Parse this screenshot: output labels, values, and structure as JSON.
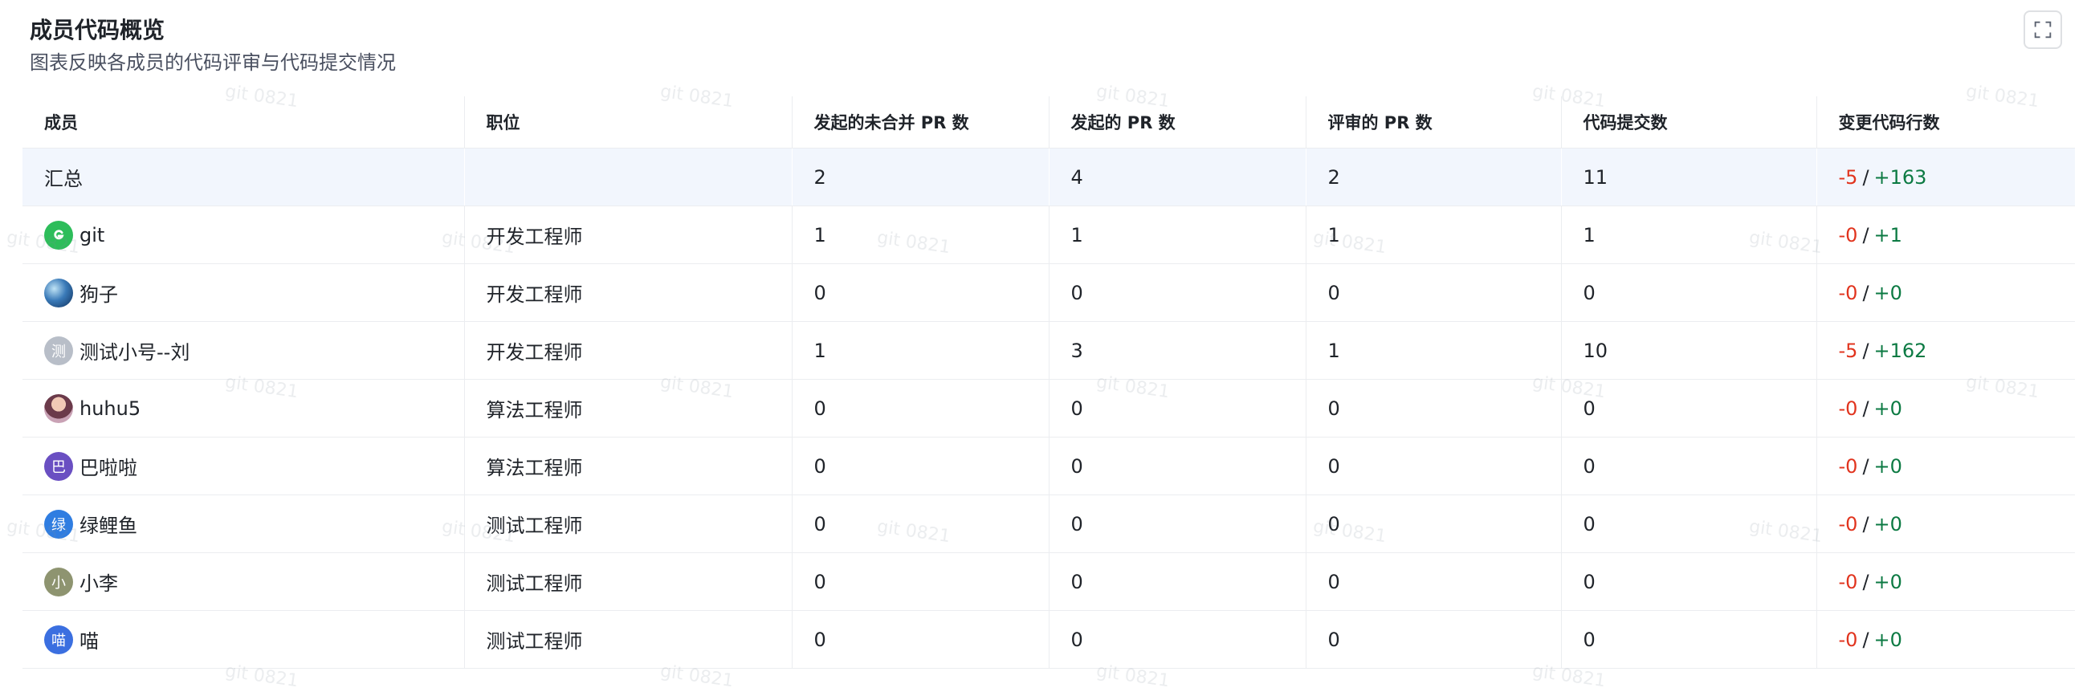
{
  "header": {
    "title": "成员代码概览",
    "subtitle": "图表反映各成员的代码评审与代码提交情况"
  },
  "toolbar": {
    "fullscreen_icon": "fullscreen-icon"
  },
  "table": {
    "columns": [
      "成员",
      "职位",
      "发起的未合并 PR 数",
      "发起的 PR 数",
      "评审的 PR 数",
      "代码提交数",
      "变更代码行数"
    ],
    "summary": {
      "member": "汇总",
      "position": "",
      "unmerged_pr": "2",
      "pr": "4",
      "reviewed_pr": "2",
      "commits": "11",
      "lines_removed": "-5",
      "lines_added": "+163"
    },
    "rows": [
      {
        "member": "git",
        "avatar_text": "",
        "position": "开发工程师",
        "unmerged_pr": "1",
        "pr": "1",
        "reviewed_pr": "1",
        "commits": "1",
        "lines_removed": "-0",
        "lines_added": "+1"
      },
      {
        "member": "狗子",
        "avatar_text": "",
        "position": "开发工程师",
        "unmerged_pr": "0",
        "pr": "0",
        "reviewed_pr": "0",
        "commits": "0",
        "lines_removed": "-0",
        "lines_added": "+0"
      },
      {
        "member": "测试小号--刘",
        "avatar_text": "测",
        "position": "开发工程师",
        "unmerged_pr": "1",
        "pr": "3",
        "reviewed_pr": "1",
        "commits": "10",
        "lines_removed": "-5",
        "lines_added": "+162"
      },
      {
        "member": "huhu5",
        "avatar_text": "",
        "position": "算法工程师",
        "unmerged_pr": "0",
        "pr": "0",
        "reviewed_pr": "0",
        "commits": "0",
        "lines_removed": "-0",
        "lines_added": "+0"
      },
      {
        "member": "巴啦啦",
        "avatar_text": "巴",
        "position": "算法工程师",
        "unmerged_pr": "0",
        "pr": "0",
        "reviewed_pr": "0",
        "commits": "0",
        "lines_removed": "-0",
        "lines_added": "+0"
      },
      {
        "member": "绿鲤鱼",
        "avatar_text": "绿",
        "position": "测试工程师",
        "unmerged_pr": "0",
        "pr": "0",
        "reviewed_pr": "0",
        "commits": "0",
        "lines_removed": "-0",
        "lines_added": "+0"
      },
      {
        "member": "小李",
        "avatar_text": "小",
        "position": "测试工程师",
        "unmerged_pr": "0",
        "pr": "0",
        "reviewed_pr": "0",
        "commits": "0",
        "lines_removed": "-0",
        "lines_added": "+0"
      },
      {
        "member": "喵",
        "avatar_text": "喵",
        "position": "测试工程师",
        "unmerged_pr": "0",
        "pr": "0",
        "reviewed_pr": "0",
        "commits": "0",
        "lines_removed": "-0",
        "lines_added": "+0"
      }
    ]
  },
  "watermark": {
    "text": "git 0821"
  },
  "colors": {
    "negative": "#e1341e",
    "positive": "#0c7a43",
    "summary_bg": "#f2f6fd"
  }
}
